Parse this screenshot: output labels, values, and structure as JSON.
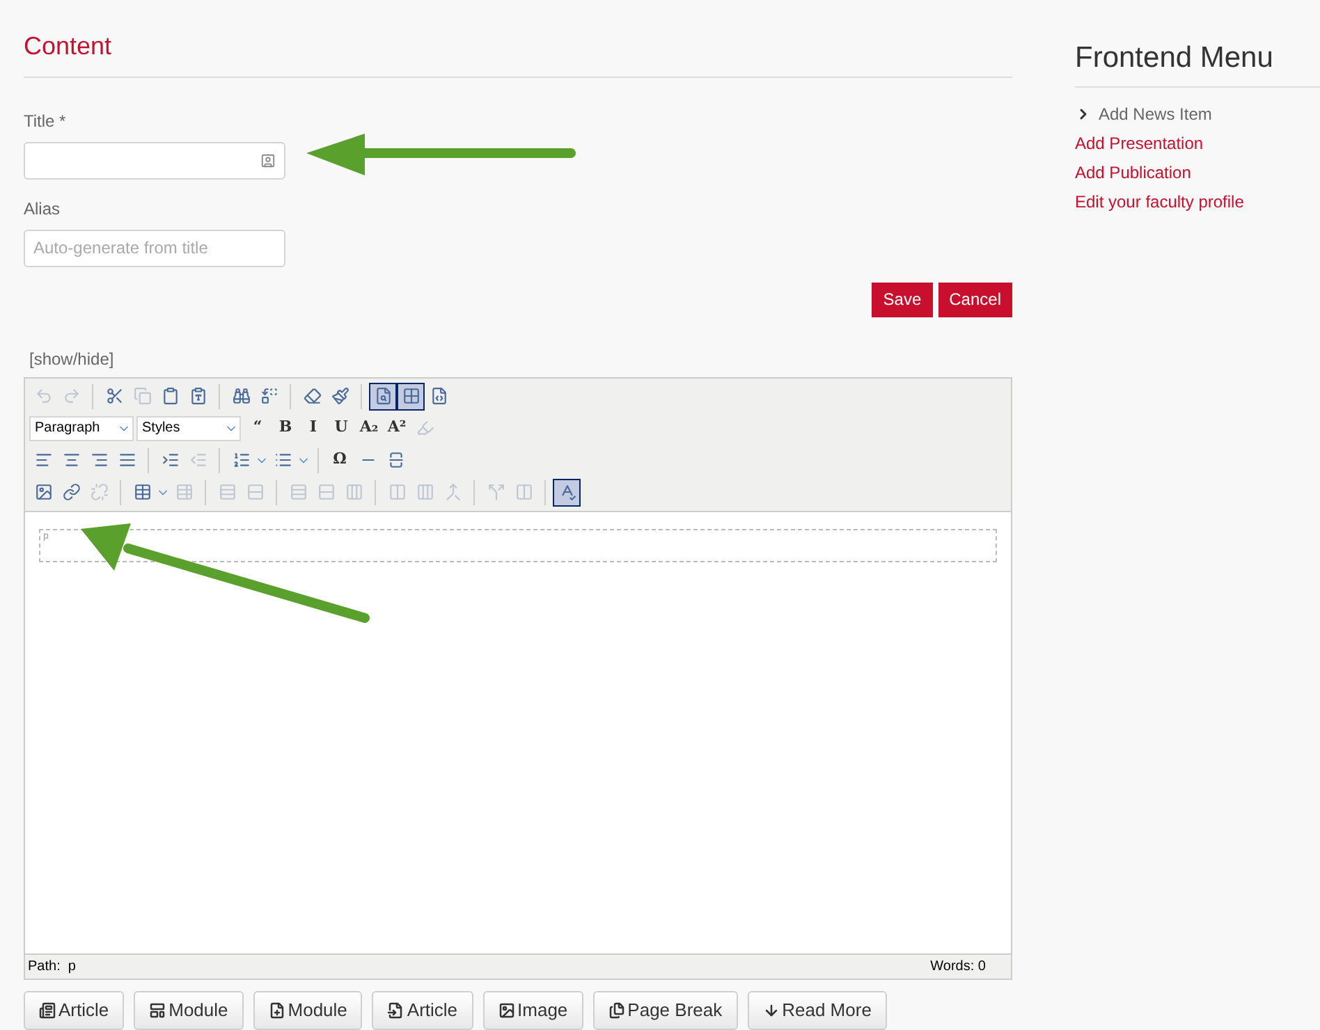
{
  "content": {
    "heading": "Content",
    "title_field": {
      "label": "Title *"
    },
    "alias_field": {
      "label": "Alias",
      "placeholder": "Auto-generate from title"
    },
    "buttons": [
      "Save",
      "Cancel"
    ]
  },
  "editor": {
    "toggle": "[show/hide]",
    "toolbar": [
      [
        {
          "kind": "button",
          "disabled": true,
          "active": false
        },
        {
          "kind": "button",
          "disabled": true,
          "active": false
        },
        {
          "kind": "separator"
        },
        {
          "kind": "button",
          "disabled": false,
          "active": false
        },
        {
          "kind": "button",
          "disabled": true,
          "active": false
        },
        {
          "kind": "button",
          "disabled": false,
          "active": false
        },
        {
          "kind": "button",
          "disabled": false,
          "active": false
        },
        {
          "kind": "separator"
        },
        {
          "kind": "button",
          "disabled": false,
          "active": false
        },
        {
          "kind": "button",
          "disabled": false,
          "active": false
        },
        {
          "kind": "separator"
        },
        {
          "kind": "button",
          "disabled": false,
          "active": false
        },
        {
          "kind": "button",
          "disabled": false,
          "active": false
        },
        {
          "kind": "separator"
        },
        {
          "kind": "button",
          "disabled": false,
          "active": true
        },
        {
          "kind": "button",
          "disabled": false,
          "active": true
        },
        {
          "kind": "button",
          "disabled": false,
          "active": false
        }
      ],
      [
        {
          "kind": "select",
          "value": "Paragraph"
        },
        {
          "kind": "select",
          "value": "Styles"
        },
        {
          "kind": "button",
          "label": "“",
          "disabled": false,
          "active": false
        },
        {
          "kind": "button",
          "label": "B",
          "disabled": false,
          "active": false
        },
        {
          "kind": "button",
          "label": "I",
          "disabled": false,
          "active": false
        },
        {
          "kind": "button",
          "label": "U",
          "disabled": false,
          "active": false
        },
        {
          "kind": "button",
          "label": "A₂",
          "disabled": false,
          "active": false
        },
        {
          "kind": "button",
          "label": "A²",
          "disabled": false,
          "active": false
        },
        {
          "kind": "button",
          "disabled": true,
          "active": false
        }
      ],
      [
        {
          "kind": "button",
          "disabled": false,
          "active": false
        },
        {
          "kind": "button",
          "disabled": false,
          "active": false
        },
        {
          "kind": "button",
          "disabled": false,
          "active": false
        },
        {
          "kind": "button",
          "disabled": false,
          "active": false
        },
        {
          "kind": "separator"
        },
        {
          "kind": "button",
          "disabled": false,
          "active": false
        },
        {
          "kind": "button",
          "disabled": true,
          "active": false
        },
        {
          "kind": "separator"
        },
        {
          "kind": "button",
          "disabled": false,
          "active": false
        },
        {
          "kind": "button",
          "disabled": false,
          "active": false
        },
        {
          "kind": "separator"
        },
        {
          "kind": "button",
          "label": "Ω",
          "disabled": false,
          "active": false
        },
        {
          "kind": "button",
          "disabled": false,
          "active": false
        },
        {
          "kind": "button",
          "disabled": false,
          "active": false
        }
      ],
      [
        {
          "kind": "button",
          "disabled": false,
          "active": false
        },
        {
          "kind": "button",
          "disabled": false,
          "active": false
        },
        {
          "kind": "button",
          "disabled": true,
          "active": false
        },
        {
          "kind": "separator"
        },
        {
          "kind": "button",
          "disabled": false,
          "active": false
        },
        {
          "kind": "button",
          "disabled": true,
          "active": false
        },
        {
          "kind": "separator"
        },
        {
          "kind": "button",
          "disabled": true,
          "active": false
        },
        {
          "kind": "button",
          "disabled": true,
          "active": false
        },
        {
          "kind": "separator"
        },
        {
          "kind": "button",
          "disabled": true,
          "active": false
        },
        {
          "kind": "button",
          "disabled": true,
          "active": false
        },
        {
          "kind": "button",
          "disabled": true,
          "active": false
        },
        {
          "kind": "separator"
        },
        {
          "kind": "button",
          "disabled": true,
          "active": false
        },
        {
          "kind": "button",
          "disabled": true,
          "active": false
        },
        {
          "kind": "button",
          "disabled": true,
          "active": false
        },
        {
          "kind": "separator"
        },
        {
          "kind": "button",
          "disabled": true,
          "active": false
        },
        {
          "kind": "button",
          "disabled": true,
          "active": false
        },
        {
          "kind": "separator"
        },
        {
          "kind": "button",
          "disabled": false,
          "active": true
        }
      ]
    ],
    "block_tag": "p",
    "path": "Path:  p",
    "words": "Words: 0"
  },
  "insert_buttons": [
    "Article",
    "Module",
    "Module",
    "Article",
    "Image",
    "Page Break",
    "Read More"
  ],
  "frontend_menu": {
    "heading": "Frontend Menu",
    "items": [
      {
        "label": "Add News Item",
        "selected": true
      },
      {
        "label": "Add Presentation",
        "selected": false
      },
      {
        "label": "Add Publication",
        "selected": false
      },
      {
        "label": "Edit your faculty profile",
        "selected": false
      }
    ]
  }
}
